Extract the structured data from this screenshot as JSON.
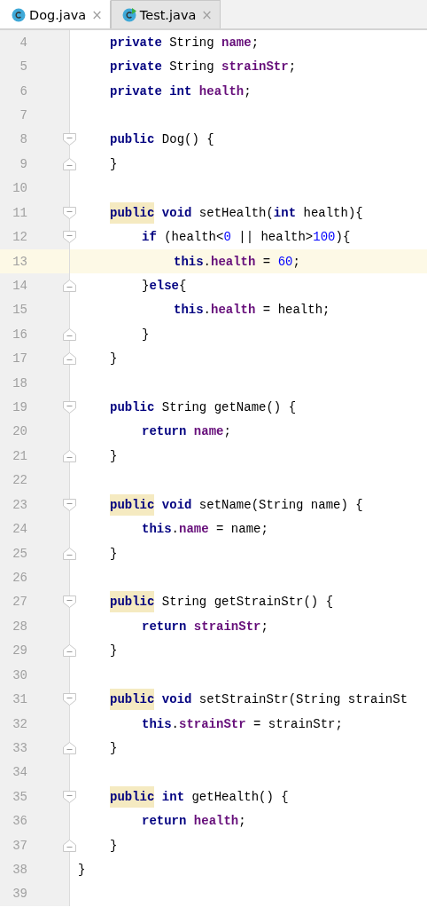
{
  "tabs": [
    {
      "label": "Dog.java",
      "kind": "class",
      "selected": true,
      "close": "×"
    },
    {
      "label": "Test.java",
      "kind": "runnable-class",
      "selected": false,
      "close": "×"
    }
  ],
  "lines": [
    {
      "children": [
        {
          "number": "4",
          "kind": "plain",
          "current": false,
          "tokens": [
            {
              "text": "private",
              "kind": "keyword"
            },
            {
              "text": " String ",
              "kind": "plain"
            },
            {
              "text": "name",
              "kind": "field"
            },
            {
              "text": ";",
              "kind": "plain"
            }
          ]
        },
        {
          "number": "5",
          "kind": "plain",
          "current": false,
          "tokens": [
            {
              "text": "private",
              "kind": "keyword"
            },
            {
              "text": " String ",
              "kind": "plain"
            },
            {
              "text": "strainStr",
              "kind": "field"
            },
            {
              "text": ";",
              "kind": "plain"
            }
          ]
        },
        {
          "number": "6",
          "kind": "plain",
          "current": false,
          "tokens": [
            {
              "text": "private int",
              "kind": "keyword"
            },
            {
              "text": " health",
              "kind": "field"
            },
            {
              "text": ";",
              "kind": "plain"
            }
          ]
        },
        {
          "number": "7",
          "kind": "plain",
          "current": false
        },
        {
          "number": "8",
          "kind": "opener",
          "current": false,
          "tokens": [
            {
              "text": "public",
              "kind": "keyword"
            },
            {
              "text": " Dog() {",
              "kind": "plain"
            }
          ]
        },
        {
          "number": "9",
          "kind": "closer",
          "current": false,
          "tokens": [
            {
              "text": "}",
              "kind": "plain"
            }
          ]
        },
        {
          "number": "10",
          "kind": "plain",
          "current": false
        },
        {
          "number": "11",
          "kind": "opener",
          "current": false,
          "tokens": [
            {
              "text": "public",
              "kind": "keyword",
              "highlighted": true
            },
            {
              "text": " void",
              "kind": "keyword"
            },
            {
              "text": " setHealth(",
              "kind": "plain"
            },
            {
              "text": "int",
              "kind": "keyword"
            },
            {
              "text": " health){",
              "kind": "plain"
            }
          ],
          "children": [
            {
              "number": "12",
              "kind": "opener",
              "current": false,
              "tokens": [
                {
                  "text": "if",
                  "kind": "keyword"
                },
                {
                  "text": " (health<",
                  "kind": "plain"
                },
                {
                  "text": "0",
                  "kind": "number"
                },
                {
                  "text": " || health>",
                  "kind": "plain"
                },
                {
                  "text": "100",
                  "kind": "number"
                },
                {
                  "text": "){",
                  "kind": "plain"
                }
              ],
              "children": [
                {
                  "number": "13",
                  "kind": "plain",
                  "current": true,
                  "tokens": [
                    {
                      "text": "this",
                      "kind": "keyword"
                    },
                    {
                      "text": ".",
                      "kind": "plain"
                    },
                    {
                      "text": "health",
                      "kind": "field"
                    },
                    {
                      "text": " = ",
                      "kind": "plain"
                    },
                    {
                      "text": "60",
                      "kind": "number"
                    },
                    {
                      "text": ";",
                      "kind": "plain"
                    }
                  ]
                }
              ]
            },
            {
              "number": "14",
              "kind": "closer",
              "current": false,
              "tokens": [
                {
                  "text": "}",
                  "kind": "plain"
                },
                {
                  "text": "else",
                  "kind": "keyword"
                },
                {
                  "text": "{",
                  "kind": "plain"
                }
              ],
              "children": [
                {
                  "number": "15",
                  "kind": "plain",
                  "current": false,
                  "tokens": [
                    {
                      "text": "this",
                      "kind": "keyword"
                    },
                    {
                      "text": ".",
                      "kind": "plain"
                    },
                    {
                      "text": "health",
                      "kind": "field"
                    },
                    {
                      "text": " = health;",
                      "kind": "plain"
                    }
                  ]
                }
              ]
            },
            {
              "number": "16",
              "kind": "closer",
              "current": false,
              "tokens": [
                {
                  "text": "}",
                  "kind": "plain"
                }
              ]
            }
          ]
        },
        {
          "number": "17",
          "kind": "closer",
          "current": false,
          "tokens": [
            {
              "text": "}",
              "kind": "plain"
            }
          ]
        },
        {
          "number": "18",
          "kind": "plain",
          "current": false
        },
        {
          "number": "19",
          "kind": "opener",
          "current": false,
          "tokens": [
            {
              "text": "public",
              "kind": "keyword"
            },
            {
              "text": " String getName() {",
              "kind": "plain"
            }
          ],
          "children": [
            {
              "number": "20",
              "kind": "plain",
              "current": false,
              "tokens": [
                {
                  "text": "return",
                  "kind": "keyword"
                },
                {
                  "text": " name",
                  "kind": "field"
                },
                {
                  "text": ";",
                  "kind": "plain"
                }
              ]
            }
          ]
        },
        {
          "number": "21",
          "kind": "closer",
          "current": false,
          "tokens": [
            {
              "text": "}",
              "kind": "plain"
            }
          ]
        },
        {
          "number": "22",
          "kind": "plain",
          "current": false
        },
        {
          "number": "23",
          "kind": "opener",
          "current": false,
          "tokens": [
            {
              "text": "public",
              "kind": "keyword",
              "highlighted": true
            },
            {
              "text": " void",
              "kind": "keyword"
            },
            {
              "text": " setName(String name) {",
              "kind": "plain"
            }
          ],
          "children": [
            {
              "number": "24",
              "kind": "plain",
              "current": false,
              "tokens": [
                {
                  "text": "this",
                  "kind": "keyword"
                },
                {
                  "text": ".",
                  "kind": "plain"
                },
                {
                  "text": "name",
                  "kind": "field"
                },
                {
                  "text": " = name;",
                  "kind": "plain"
                }
              ]
            }
          ]
        },
        {
          "number": "25",
          "kind": "closer",
          "current": false,
          "tokens": [
            {
              "text": "}",
              "kind": "plain"
            }
          ]
        },
        {
          "number": "26",
          "kind": "plain",
          "current": false
        },
        {
          "number": "27",
          "kind": "opener",
          "current": false,
          "tokens": [
            {
              "text": "public",
              "kind": "keyword",
              "highlighted": true
            },
            {
              "text": " String getStrainStr() {",
              "kind": "plain"
            }
          ],
          "children": [
            {
              "number": "28",
              "kind": "plain",
              "current": false,
              "tokens": [
                {
                  "text": "return",
                  "kind": "keyword"
                },
                {
                  "text": " strainStr",
                  "kind": "field"
                },
                {
                  "text": ";",
                  "kind": "plain"
                }
              ]
            }
          ]
        },
        {
          "number": "29",
          "kind": "closer",
          "current": false,
          "tokens": [
            {
              "text": "}",
              "kind": "plain"
            }
          ]
        },
        {
          "number": "30",
          "kind": "plain",
          "current": false
        },
        {
          "number": "31",
          "kind": "opener",
          "current": false,
          "tokens": [
            {
              "text": "public",
              "kind": "keyword",
              "highlighted": true
            },
            {
              "text": " void",
              "kind": "keyword"
            },
            {
              "text": " setStrainStr(String strainSt",
              "kind": "plain"
            }
          ],
          "children": [
            {
              "number": "32",
              "kind": "plain",
              "current": false,
              "tokens": [
                {
                  "text": "this",
                  "kind": "keyword"
                },
                {
                  "text": ".",
                  "kind": "plain"
                },
                {
                  "text": "strainStr",
                  "kind": "field"
                },
                {
                  "text": " = strainStr;",
                  "kind": "plain"
                }
              ]
            }
          ]
        },
        {
          "number": "33",
          "kind": "closer",
          "current": false,
          "tokens": [
            {
              "text": "}",
              "kind": "plain"
            }
          ]
        },
        {
          "number": "34",
          "kind": "plain",
          "current": false
        },
        {
          "number": "35",
          "kind": "opener",
          "current": false,
          "tokens": [
            {
              "text": "public",
              "kind": "keyword",
              "highlighted": true
            },
            {
              "text": " int",
              "kind": "keyword"
            },
            {
              "text": " getHealth() {",
              "kind": "plain"
            }
          ],
          "children": [
            {
              "number": "36",
              "kind": "plain",
              "current": false,
              "tokens": [
                {
                  "text": "return",
                  "kind": "keyword"
                },
                {
                  "text": " health",
                  "kind": "field"
                },
                {
                  "text": ";",
                  "kind": "plain"
                }
              ]
            }
          ]
        },
        {
          "number": "37",
          "kind": "closer",
          "current": false,
          "tokens": [
            {
              "text": "}",
              "kind": "plain"
            }
          ]
        }
      ]
    },
    {
      "number": "38",
      "kind": "plain",
      "current": false,
      "tokens": [
        {
          "text": "}",
          "kind": "plain"
        }
      ]
    },
    {
      "number": "39",
      "kind": "plain",
      "current": false
    }
  ]
}
